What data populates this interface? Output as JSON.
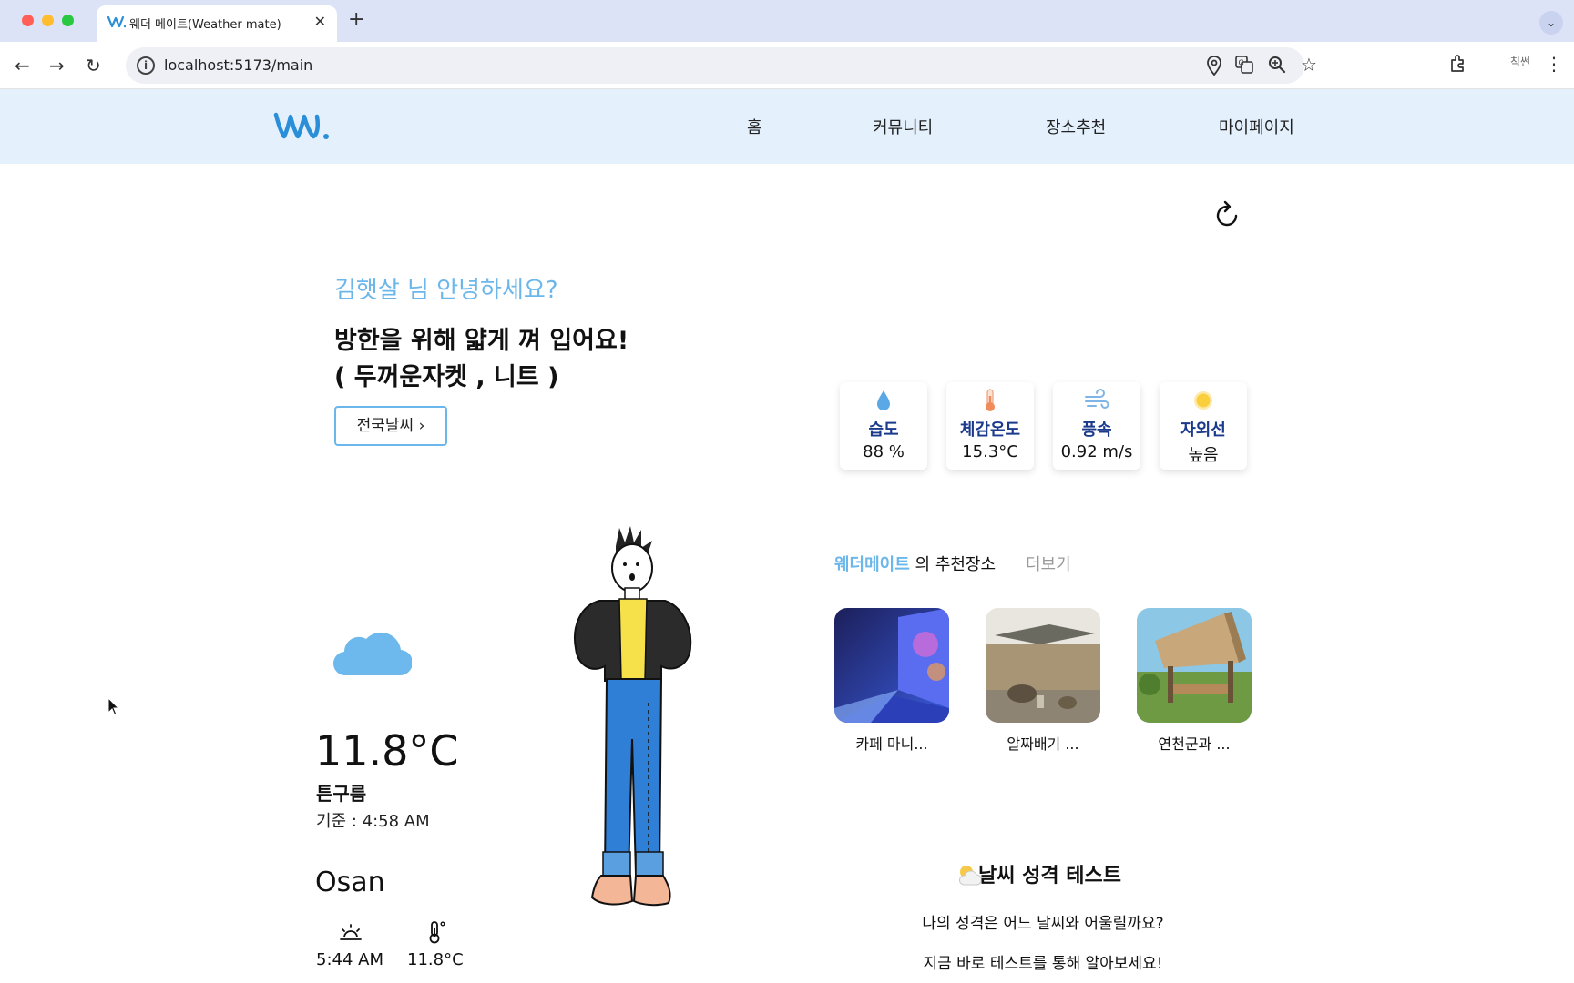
{
  "browser": {
    "tab_title": "웨더 메이트(Weather mate)",
    "url": "localhost:5173/main",
    "profile_label": "칙썬"
  },
  "header": {
    "nav": [
      "홈",
      "커뮤니티",
      "장소추천",
      "마이페이지"
    ]
  },
  "hero": {
    "greeting": "김햇살 님 안녕하세요?",
    "advice_line1": "방한을 위해 얇게 껴 입어요!",
    "advice_line2": "( 두꺼운자켓 , 니트 )",
    "nation_button": "전국날씨 ›"
  },
  "stats": [
    {
      "label": "습도",
      "value": "88 %",
      "icon": "water-drop-icon"
    },
    {
      "label": "체감온도",
      "value": "15.3°C",
      "icon": "thermometer-icon"
    },
    {
      "label": "풍속",
      "value": "0.92 m/s",
      "icon": "wind-icon"
    },
    {
      "label": "자외선",
      "value": "높음",
      "icon": "sun-icon"
    }
  ],
  "weather": {
    "icon": "cloud-icon",
    "temperature": "11.8°C",
    "sky": "튼구름",
    "based_on": "기준 : 4:58 AM",
    "city": "Osan",
    "sunrise": "5:44 AM",
    "current_temp": "11.8°C"
  },
  "recommend": {
    "brand": "웨더메이트",
    "title_suffix": " 의 추천장소",
    "more": "더보기",
    "places": [
      {
        "name": "카페 마니..."
      },
      {
        "name": "알짜배기 ..."
      },
      {
        "name": "연천군과 ..."
      }
    ]
  },
  "test": {
    "title": "날씨 성격 테스트",
    "line1": "나의 성격은 어느 날씨와 어울릴까요?",
    "line2": "지금 바로 테스트를 통해 알아보세요!"
  },
  "colors": {
    "accent": "#6bb6ea",
    "header_bg": "#e4f1fd",
    "stat_label": "#1b3a8c"
  }
}
